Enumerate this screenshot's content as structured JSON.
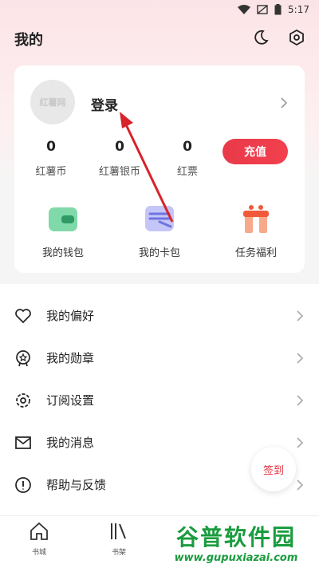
{
  "status_bar": {
    "time": "5:17"
  },
  "header": {
    "title": "我的"
  },
  "profile": {
    "avatar_text": "红薯网",
    "login_label": "登录",
    "stats": [
      {
        "value": "0",
        "label": "红薯币"
      },
      {
        "value": "0",
        "label": "红薯银币"
      },
      {
        "value": "0",
        "label": "红票"
      }
    ],
    "recharge_label": "充值"
  },
  "quick_actions": [
    {
      "label": "我的钱包",
      "icon": "wallet-icon"
    },
    {
      "label": "我的卡包",
      "icon": "card-pack-icon"
    },
    {
      "label": "任务福利",
      "icon": "gift-icon"
    }
  ],
  "menu": [
    {
      "label": "我的偏好",
      "icon": "heart-icon"
    },
    {
      "label": "我的勋章",
      "icon": "medal-icon"
    },
    {
      "label": "订阅设置",
      "icon": "gear-icon"
    },
    {
      "label": "我的消息",
      "icon": "mail-icon"
    },
    {
      "label": "帮助与反馈",
      "icon": "help-icon"
    }
  ],
  "signin_label": "签到",
  "bottom_nav": [
    {
      "label": "书城",
      "icon": "home-icon"
    },
    {
      "label": "书架",
      "icon": "bookshelf-icon"
    }
  ],
  "watermark": {
    "title": "谷普软件园",
    "url": "www.gupuxiazai.com"
  },
  "colors": {
    "accent": "#e93a4a",
    "watermark": "#1a9c3e",
    "annotation_arrow": "#d8232a"
  }
}
